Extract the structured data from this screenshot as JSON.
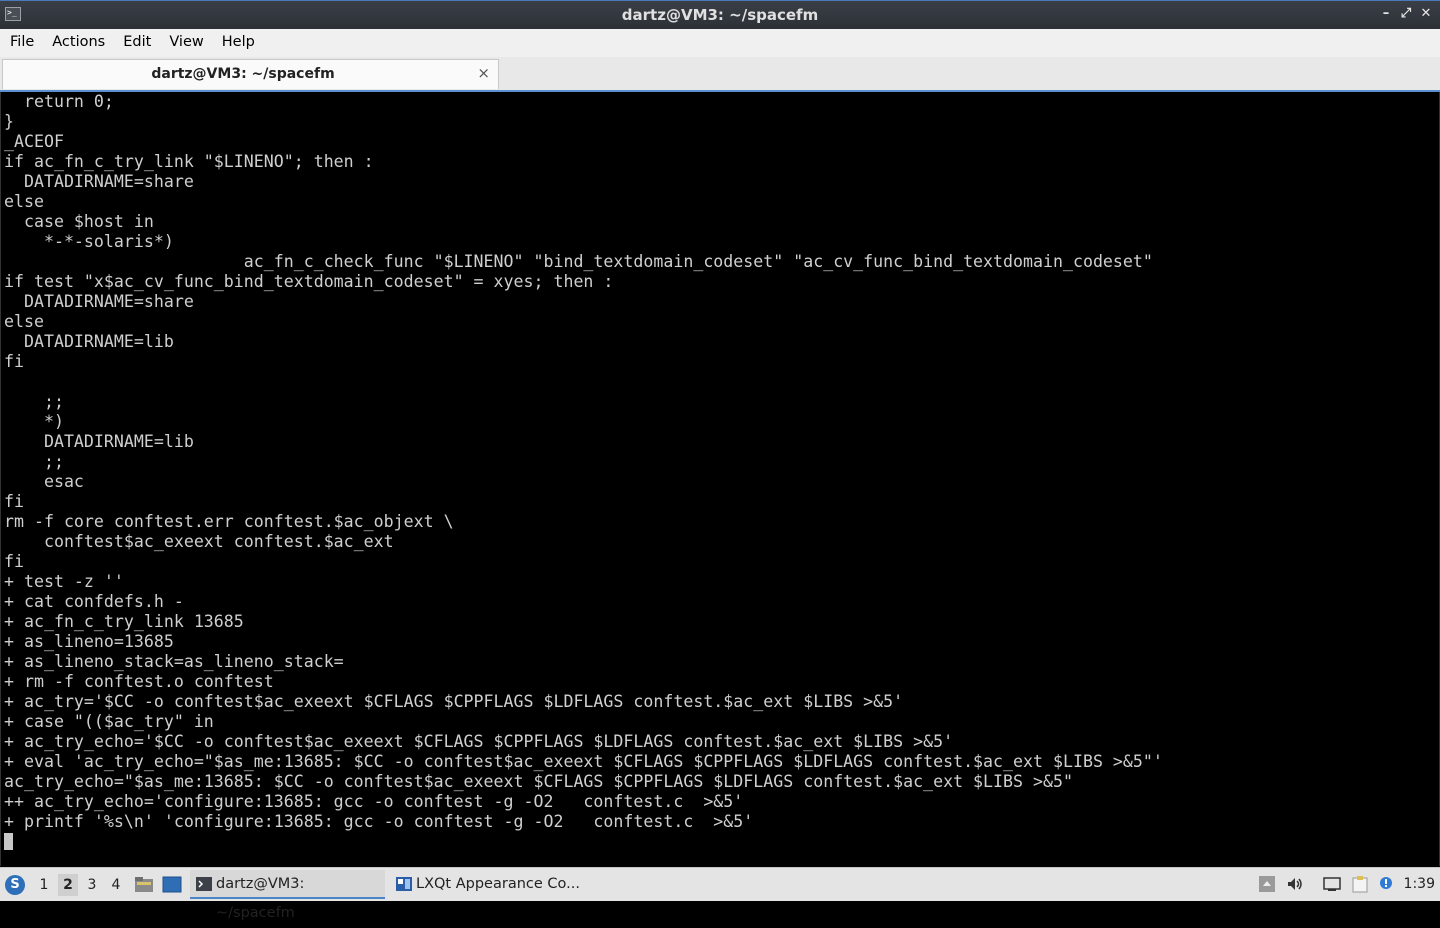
{
  "window": {
    "title": "dartz@VM3: ~/spacefm",
    "icon": "terminal-icon",
    "controls": [
      "minimize-icon",
      "maximize-icon",
      "close-icon"
    ]
  },
  "menu": {
    "file": "File",
    "actions": "Actions",
    "edit": "Edit",
    "view": "View",
    "help": "Help"
  },
  "tab": {
    "label": "dartz@VM3: ~/spacefm",
    "close": "×"
  },
  "terminal": {
    "lines": [
      "  return 0;",
      "}",
      "_ACEOF",
      "if ac_fn_c_try_link \"$LINENO\"; then :",
      "  DATADIRNAME=share",
      "else",
      "  case $host in",
      "    *-*-solaris*)",
      "                        ac_fn_c_check_func \"$LINENO\" \"bind_textdomain_codeset\" \"ac_cv_func_bind_textdomain_codeset\"",
      "if test \"x$ac_cv_func_bind_textdomain_codeset\" = xyes; then :",
      "  DATADIRNAME=share",
      "else",
      "  DATADIRNAME=lib",
      "fi",
      "",
      "    ;;",
      "    *)",
      "    DATADIRNAME=lib",
      "    ;;",
      "    esac",
      "fi",
      "rm -f core conftest.err conftest.$ac_objext \\",
      "    conftest$ac_exeext conftest.$ac_ext",
      "fi",
      "+ test -z ''",
      "+ cat confdefs.h -",
      "+ ac_fn_c_try_link 13685",
      "+ as_lineno=13685",
      "+ as_lineno_stack=as_lineno_stack=",
      "+ rm -f conftest.o conftest",
      "+ ac_try='$CC -o conftest$ac_exeext $CFLAGS $CPPFLAGS $LDFLAGS conftest.$ac_ext $LIBS >&5'",
      "+ case \"(($ac_try\" in",
      "+ ac_try_echo='$CC -o conftest$ac_exeext $CFLAGS $CPPFLAGS $LDFLAGS conftest.$ac_ext $LIBS >&5'",
      "+ eval 'ac_try_echo=\"$as_me:13685: $CC -o conftest$ac_exeext $CFLAGS $CPPFLAGS $LDFLAGS conftest.$ac_ext $LIBS >&5\"'",
      "ac_try_echo=\"$as_me:13685: $CC -o conftest$ac_exeext $CFLAGS $CPPFLAGS $LDFLAGS conftest.$ac_ext $LIBS >&5\"",
      "++ ac_try_echo='configure:13685: gcc -o conftest -g -O2   conftest.c  >&5'",
      "+ printf '%s\\n' 'configure:13685: gcc -o conftest -g -O2   conftest.c  >&5'"
    ]
  },
  "taskbar": {
    "desktops": [
      "1",
      "2",
      "3",
      "4"
    ],
    "active_desktop": "2",
    "tasks": [
      {
        "label": "dartz@VM3: ~/spacefm",
        "icon": "terminal-icon"
      },
      {
        "label": "LXQt Appearance Co...",
        "icon": "appearance-icon"
      }
    ],
    "clock": "1:39"
  },
  "colors": {
    "accent": "#4a86c8",
    "terminal_bg": "#000000",
    "terminal_fg": "#cfcfcf"
  }
}
